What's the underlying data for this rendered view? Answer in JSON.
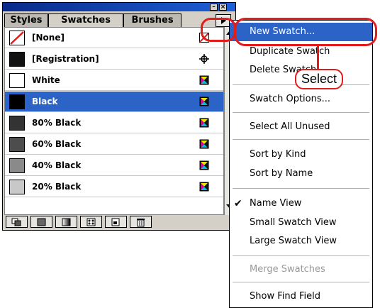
{
  "palette": {
    "tabs": [
      "Styles",
      "Swatches",
      "Brushes"
    ],
    "active_tab": "Swatches",
    "title_buttons": [
      "minimize-icon",
      "close-icon"
    ],
    "swatches": [
      {
        "name": "[None]",
        "chip": "none",
        "icon": "none-icon"
      },
      {
        "name": "[Registration]",
        "chip": "#111111",
        "icon": "registration-icon"
      },
      {
        "name": "White",
        "chip": "#ffffff",
        "icon": "process-color-icon"
      },
      {
        "name": "Black",
        "chip": "#000000",
        "icon": "process-color-icon",
        "selected": true
      },
      {
        "name": "80% Black",
        "chip": "#333333",
        "icon": "process-color-icon"
      },
      {
        "name": "60% Black",
        "chip": "#4d4d4d",
        "icon": "process-color-icon"
      },
      {
        "name": "40% Black",
        "chip": "#8a8a8a",
        "icon": "process-color-icon"
      },
      {
        "name": "20% Black",
        "chip": "#c8c8c8",
        "icon": "process-color-icon"
      }
    ],
    "bottom_buttons": [
      "show-all-icon",
      "show-color-icon",
      "show-gradient-icon",
      "show-pattern-icon",
      "new-swatch-icon",
      "delete-icon"
    ]
  },
  "menu": {
    "items": [
      {
        "label": "New Swatch...",
        "highlighted": true
      },
      {
        "label": "Duplicate Swatch"
      },
      {
        "label": "Delete Swatch"
      },
      {
        "label": "Swatch Options..."
      },
      {
        "label": "Select All Unused"
      },
      {
        "label": "Sort by Kind"
      },
      {
        "label": "Sort by Name"
      },
      {
        "label": "Name View",
        "checked": true
      },
      {
        "label": "Small Swatch View"
      },
      {
        "label": "Large Swatch View"
      },
      {
        "label": "Merge Swatches",
        "disabled": true
      },
      {
        "label": "Show Find Field"
      }
    ]
  },
  "annotation": {
    "callout": "Select",
    "color": "#e21b1b"
  },
  "colors": {
    "selection": "#2b63c6",
    "title_bar": "#1d5fd6",
    "panel": "#d4d0c8"
  }
}
